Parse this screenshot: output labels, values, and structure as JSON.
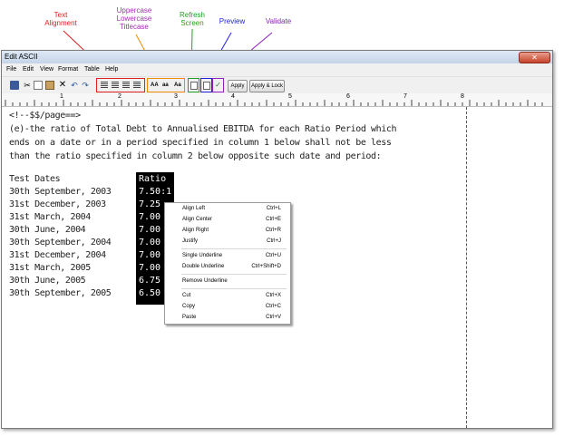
{
  "annotations": {
    "text_alignment": "Text\nAlignment",
    "case": "Uppercase\nLowercase\nTitlecase",
    "refresh": "Refresh\nScreen",
    "preview": "Preview",
    "validate": "Validate"
  },
  "window": {
    "title": "Edit ASCII",
    "close_glyph": "✕"
  },
  "menu": {
    "file": "File",
    "edit": "Edit",
    "view": "View",
    "format": "Format",
    "table": "Table",
    "help": "Help"
  },
  "toolbar": {
    "case_upper": "AA",
    "case_lower": "aa",
    "case_title": "Aa",
    "apply": "Apply",
    "apply_lock": "Apply & Lock"
  },
  "ruler": {
    "n1": "1",
    "n2": "2",
    "n3": "3",
    "n4": "4",
    "n5": "5",
    "n6": "6",
    "n7": "7",
    "n8": "8"
  },
  "editor": {
    "lines": [
      "<!--$$/page==>",
      "(e)-the ratio of Total Debt to Annualised EBITDA for each Ratio Period which",
      "ends on a date or in a period specified in column 1 below shall not be less",
      "than the ratio specified in column 2 below opposite such date and period:",
      "",
      "Test Dates",
      "30th September, 2003",
      "31st December, 2003",
      "31st March, 2004",
      "30th June, 2004",
      "30th September, 2004",
      "31st December, 2004",
      "31st March, 2005",
      "30th June, 2005",
      "30th September, 2005"
    ],
    "ratios": [
      "Ratio",
      "7.50:1",
      "7.25",
      "7.00",
      "7.00",
      "7.00",
      "7.00",
      "7.00",
      "6.75",
      "6.50"
    ]
  },
  "context_menu": [
    {
      "label": "Align Left",
      "shortcut": "Ctrl+L"
    },
    {
      "label": "Align Center",
      "shortcut": "Ctrl+E"
    },
    {
      "label": "Align Right",
      "shortcut": "Ctrl+R"
    },
    {
      "label": "Justify",
      "shortcut": "Ctrl+J"
    },
    {
      "label": "Single Underline",
      "shortcut": "Ctrl+U"
    },
    {
      "label": "Double Underline",
      "shortcut": "Ctrl+Shift+D"
    },
    {
      "label": "Remove Underline",
      "shortcut": ""
    },
    {
      "label": "Cut",
      "shortcut": "Ctrl+X"
    },
    {
      "label": "Copy",
      "shortcut": "Ctrl+C"
    },
    {
      "label": "Paste",
      "shortcut": "Ctrl+V"
    }
  ],
  "colors": {
    "alignment": "#e02020",
    "case": "#f08a00",
    "refresh": "#20a020",
    "preview": "#2020e0",
    "validate": "#9020c0"
  }
}
